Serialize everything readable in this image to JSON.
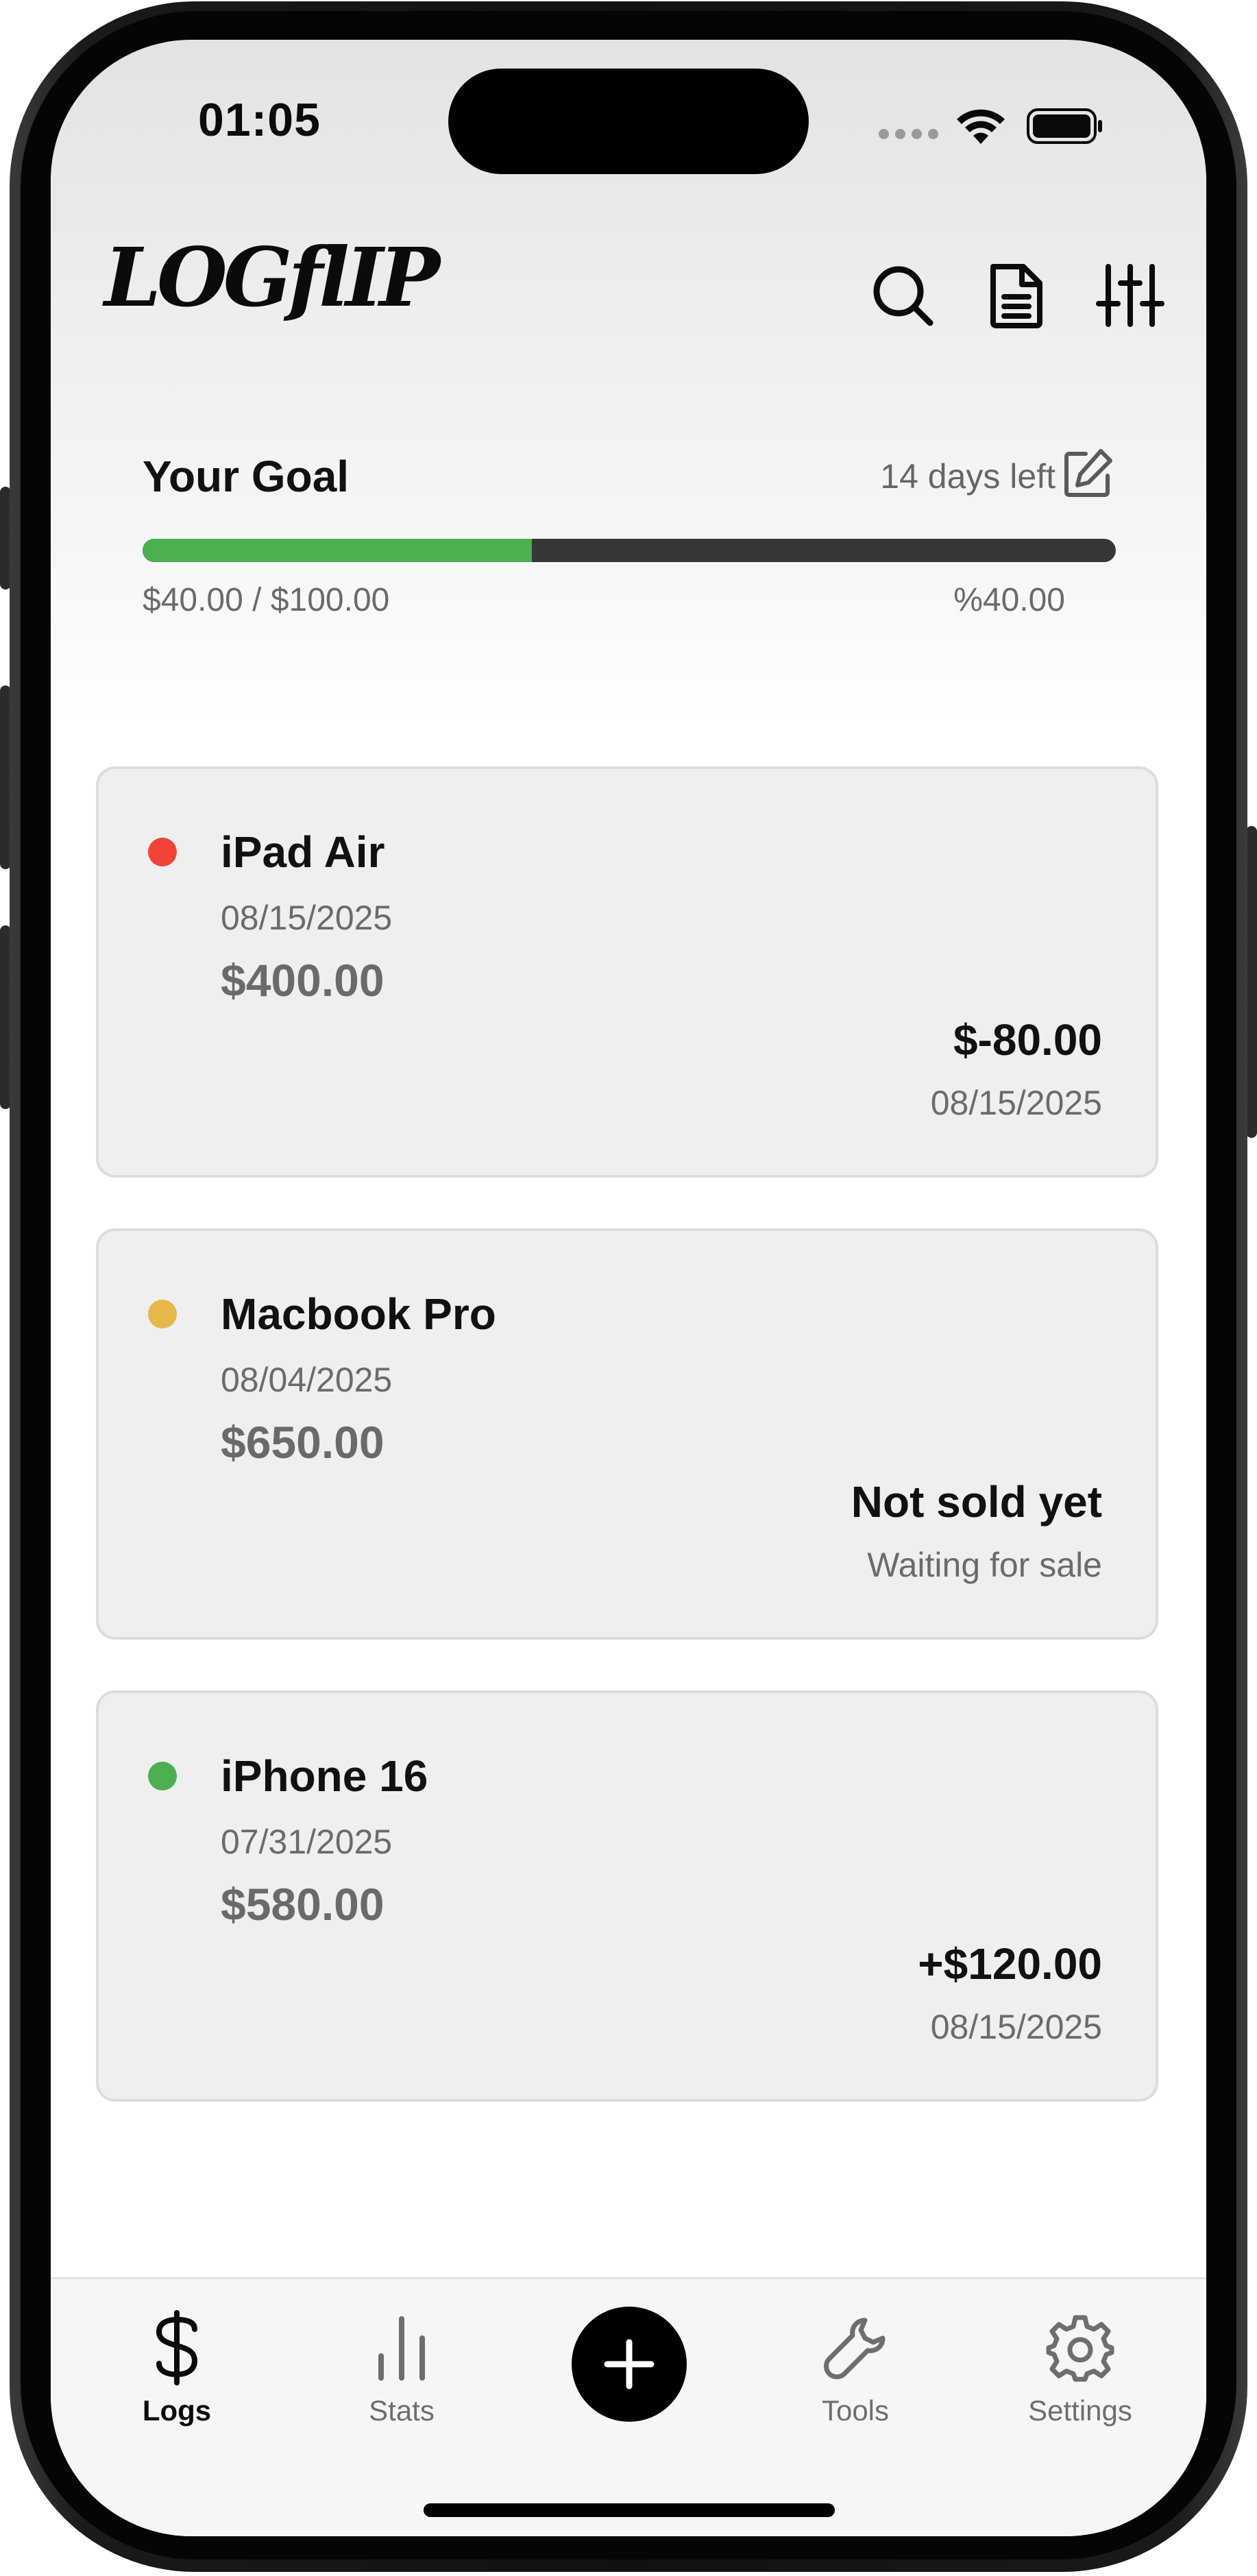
{
  "status_bar": {
    "time": "01:05"
  },
  "header": {
    "logo": "LOGflIP",
    "icons": [
      "search-icon",
      "document-icon",
      "sliders-icon"
    ]
  },
  "goal": {
    "title": "Your Goal",
    "days_left": "14 days left",
    "progress_fraction": 0.4,
    "amount_text": "$40.00 / $100.00",
    "percent_text": "%40.00",
    "fill_color": "#4caf50",
    "track_color": "#373737"
  },
  "items": [
    {
      "name": "iPad Air",
      "date": "08/15/2025",
      "price": "$400.00",
      "result": "$-80.00",
      "sub": "08/15/2025",
      "status_color": "#f44336"
    },
    {
      "name": "Macbook Pro",
      "date": "08/04/2025",
      "price": "$650.00",
      "result": "Not sold yet",
      "sub": "Waiting for sale",
      "status_color": "#e6b84a"
    },
    {
      "name": "iPhone 16",
      "date": "07/31/2025",
      "price": "$580.00",
      "result": "+$120.00",
      "sub": "08/15/2025",
      "status_color": "#4caf50"
    }
  ],
  "tabbar": {
    "tabs": [
      {
        "label": "Logs",
        "icon": "dollar-icon",
        "active": true
      },
      {
        "label": "Stats",
        "icon": "bar-chart-icon",
        "active": false
      },
      {
        "label": "Tools",
        "icon": "wrench-icon",
        "active": false
      },
      {
        "label": "Settings",
        "icon": "gear-icon",
        "active": false
      }
    ],
    "add_icon": "plus-icon"
  }
}
